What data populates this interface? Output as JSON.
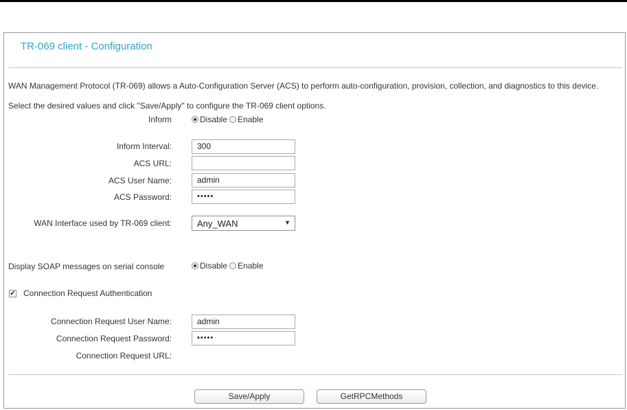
{
  "page": {
    "title": "TR-069 client - Configuration",
    "description": "WAN Management Protocol (TR-069) allows a Auto-Configuration Server (ACS) to perform auto-configuration, provision, collection, and diagnostics to this device.",
    "instruction": "Select the desired values and click \"Save/Apply\" to configure the TR-069 client options."
  },
  "inform": {
    "label": "Inform",
    "options": [
      "Disable",
      "Enable"
    ],
    "selected": "Disable"
  },
  "fields": {
    "inform_interval": {
      "label": "Inform Interval:",
      "value": "300"
    },
    "acs_url": {
      "label": "ACS URL:",
      "value": ""
    },
    "acs_user": {
      "label": "ACS User Name:",
      "value": "admin"
    },
    "acs_password": {
      "label": "ACS Password:",
      "value": "•••••"
    }
  },
  "wan_interface": {
    "label": "WAN Interface used by TR-069 client:",
    "value": "Any_WAN"
  },
  "soap": {
    "label": "Display SOAP messages on serial console",
    "options": [
      "Disable",
      "Enable"
    ],
    "selected": "Disable"
  },
  "conn_auth": {
    "label": "Connection Request Authentication",
    "checked": true,
    "user_label": "Connection Request User Name:",
    "user_value": "admin",
    "password_label": "Connection Request Password:",
    "password_value": "•••••",
    "url_label": "Connection Request URL:"
  },
  "buttons": {
    "save": "Save/Apply",
    "rpc": "GetRPCMethods"
  },
  "colors": {
    "title": "#2fa4c9",
    "border": "#9a9a9a",
    "divider": "#c8c8c8"
  }
}
